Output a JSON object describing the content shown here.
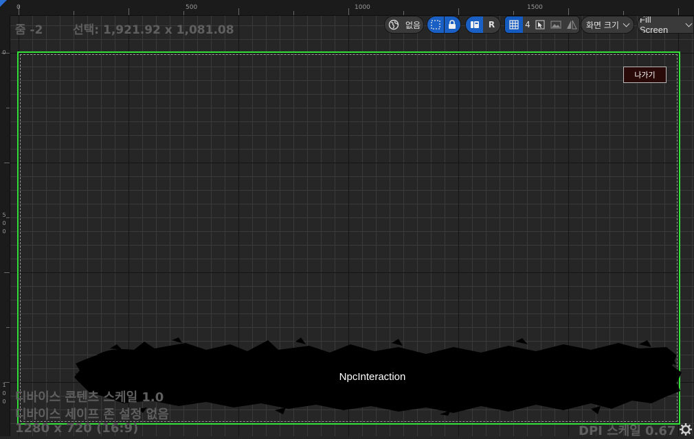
{
  "ruler": {
    "top_labels": [
      "0",
      "500",
      "1000",
      "1500"
    ],
    "left_labels": [
      "0",
      "5",
      "0",
      "0",
      "1",
      "0",
      "0"
    ]
  },
  "viewport": {
    "zoom": "줌 -2",
    "selection": "선택: 1,921.92 x 1,081.08"
  },
  "toolbar": {
    "world_label": "없음",
    "respect_lock_label": "R",
    "grid_snap_value": "4",
    "screen_size_label": "화면 크기",
    "fill_screen_label": "Fill Screen"
  },
  "widgets": {
    "exit_button_label": "나가기",
    "npc_interaction_label": "NpcInteraction"
  },
  "device_info": {
    "content_scale": "디바이스 콘텐츠 스케일 1.0",
    "safe_zone": "디바이스 세이프 존 설정 없음",
    "resolution": "1280 x 720 (16:9)",
    "dpi_scale": "DPI 스케일 0.67"
  },
  "colors": {
    "safe_frame": "#34e23a",
    "accent_blue": "#1a5fc4",
    "exit_button_bg": "#2a0a08"
  }
}
